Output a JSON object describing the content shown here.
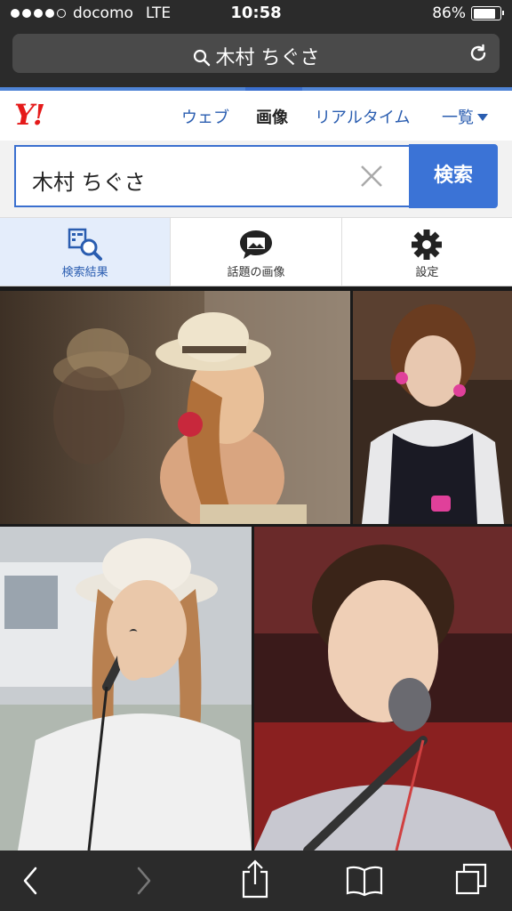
{
  "status": {
    "carrier": "docomo",
    "network": "LTE",
    "time": "10:58",
    "battery": "86%",
    "battery_level": 0.86
  },
  "browser": {
    "url_query": "木村 ちぐさ"
  },
  "header": {
    "logo": "Y!",
    "tabs": [
      {
        "label": "ウェブ"
      },
      {
        "label": "画像"
      },
      {
        "label": "リアルタイム"
      },
      {
        "label": "一覧"
      }
    ]
  },
  "search": {
    "value": "木村 ちぐさ",
    "button_label": "検索"
  },
  "tools": [
    {
      "label": "検索結果",
      "icon": "search-results-icon"
    },
    {
      "label": "話題の画像",
      "icon": "trending-images-icon"
    },
    {
      "label": "設定",
      "icon": "gear-icon"
    }
  ],
  "results": {
    "count_visible": 4
  },
  "colors": {
    "accent": "#3b73d6",
    "logo": "#e51a1a",
    "chrome": "#2b2b2b"
  }
}
